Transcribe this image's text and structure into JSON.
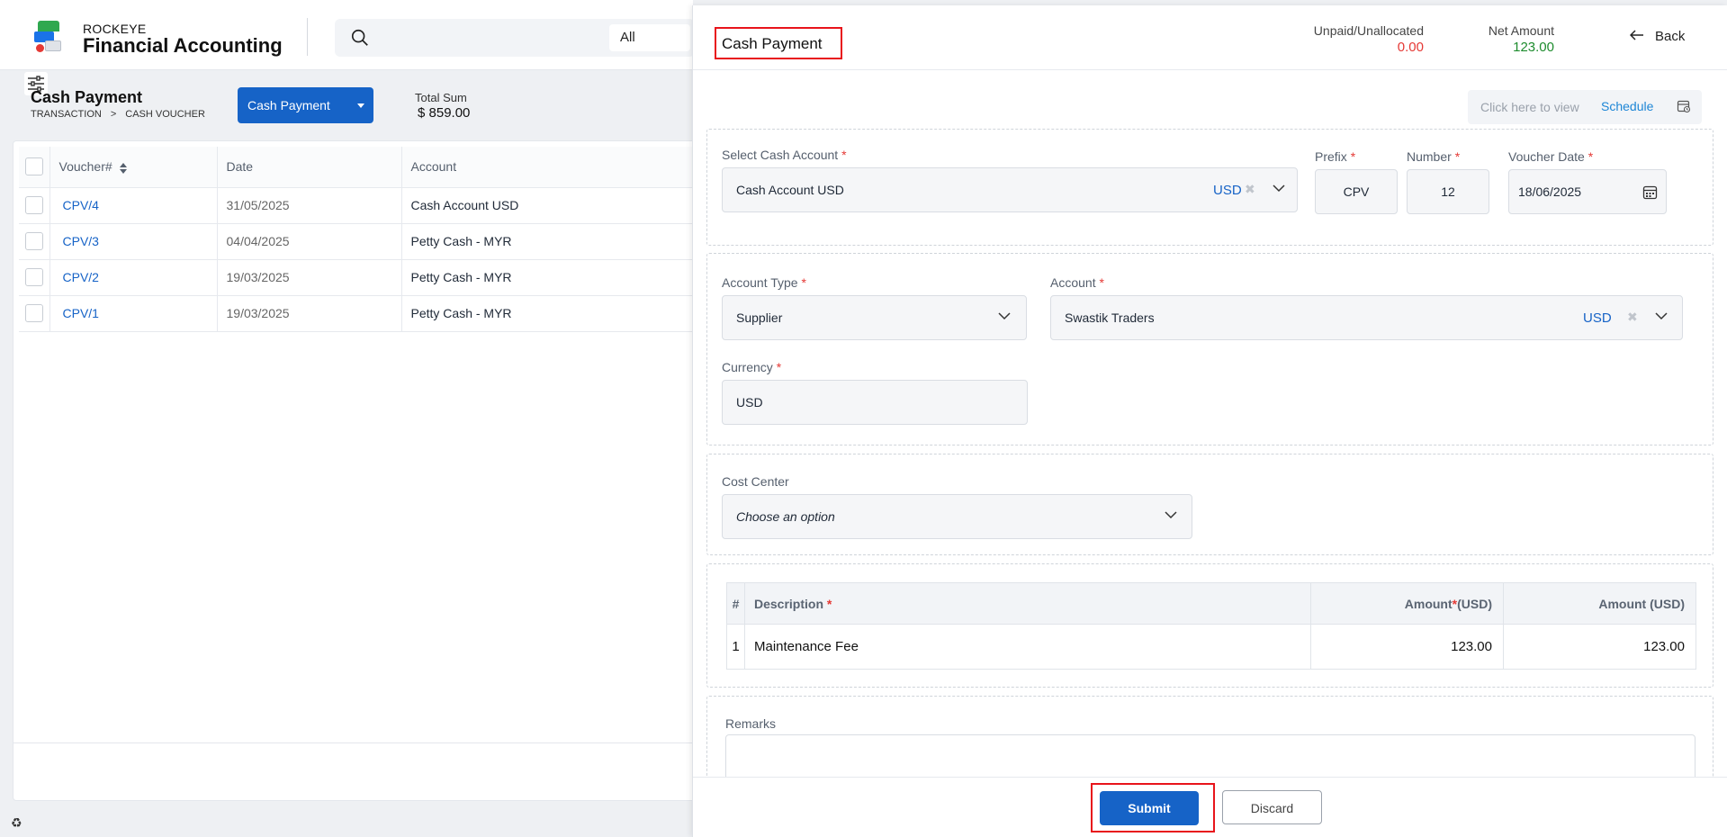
{
  "app": {
    "brand_top": "ROCKEYE",
    "brand_main": "Financial Accounting",
    "search_scope": "All"
  },
  "list_page": {
    "title": "Cash Payment",
    "breadcrumb": [
      "TRANSACTION",
      ">",
      "CASH VOUCHER"
    ],
    "new_button_label": "Cash Payment",
    "total_label": "Total Sum",
    "total_value": "$ 859.00",
    "columns": [
      "Voucher#",
      "Date",
      "Account"
    ],
    "rows": [
      {
        "voucher": "CPV/4",
        "date": "31/05/2025",
        "account": "Cash Account USD"
      },
      {
        "voucher": "CPV/3",
        "date": "04/04/2025",
        "account": "Petty Cash - MYR"
      },
      {
        "voucher": "CPV/2",
        "date": "19/03/2025",
        "account": "Petty Cash - MYR"
      },
      {
        "voucher": "CPV/1",
        "date": "19/03/2025",
        "account": "Petty Cash - MYR"
      }
    ]
  },
  "drawer": {
    "title": "Cash Payment",
    "unpaid_label": "Unpaid/Unallocated",
    "unpaid_value": "0.00",
    "net_label": "Net Amount",
    "net_value": "123.00",
    "back_label": "Back",
    "schedule_hint": "Click here to view",
    "schedule_link": "Schedule",
    "cash_account_label": "Select Cash Account",
    "cash_account_value": "Cash Account USD",
    "cash_account_currency": "USD",
    "prefix_label": "Prefix",
    "prefix_value": "CPV",
    "number_label": "Number",
    "number_value": "12",
    "voucher_date_label": "Voucher Date",
    "voucher_date_value": "18/06/2025",
    "account_type_label": "Account Type",
    "account_type_value": "Supplier",
    "account_label": "Account",
    "account_value": "Swastik Traders",
    "account_currency": "USD",
    "currency_label": "Currency",
    "currency_value": "USD",
    "cost_center_label": "Cost Center",
    "cost_center_placeholder": "Choose an option",
    "lines_columns": {
      "num": "#",
      "description": "Description",
      "amount_req": "Amount",
      "amount_req_unit": "(USD)",
      "amount": "Amount (USD)"
    },
    "lines": [
      {
        "num": "1",
        "description": "Maintenance Fee",
        "amount_doc": "123.00",
        "amount_base": "123.00"
      }
    ],
    "remarks_label": "Remarks",
    "submit_label": "Submit",
    "discard_label": "Discard",
    "required_mark": "*"
  },
  "colors": {
    "primary": "#1663c7",
    "negative": "#e53935",
    "positive": "#1e8c2e",
    "highlight": "#e8141b"
  }
}
